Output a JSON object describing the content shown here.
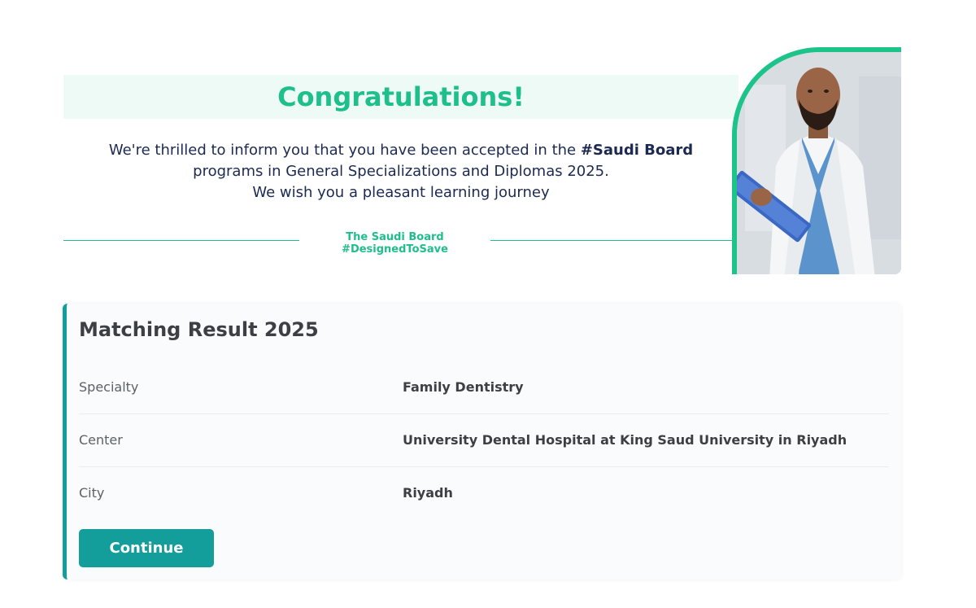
{
  "banner": {
    "title": "Congratulations!",
    "message": {
      "line1_prefix": "We're thrilled to inform you that you have been accepted in the ",
      "line1_bold": "#Saudi Board",
      "line2": "programs in General Specializations and Diplomas 2025.",
      "line3": "We wish you a pleasant learning journey"
    },
    "tagline": "The Saudi Board #DesignedToSave"
  },
  "result": {
    "title": "Matching Result 2025",
    "rows": [
      {
        "label": "Specialty",
        "value": "Family Dentistry"
      },
      {
        "label": "Center",
        "value": "University Dental Hospital at King Saud University in Riyadh"
      },
      {
        "label": "City",
        "value": "Riyadh"
      }
    ],
    "continue_label": "Continue"
  },
  "colors": {
    "accent_green": "#1dbf8a",
    "teal": "#139e9b",
    "navy_text": "#1c2a52"
  },
  "icons": {
    "photo": "doctor-photo"
  }
}
